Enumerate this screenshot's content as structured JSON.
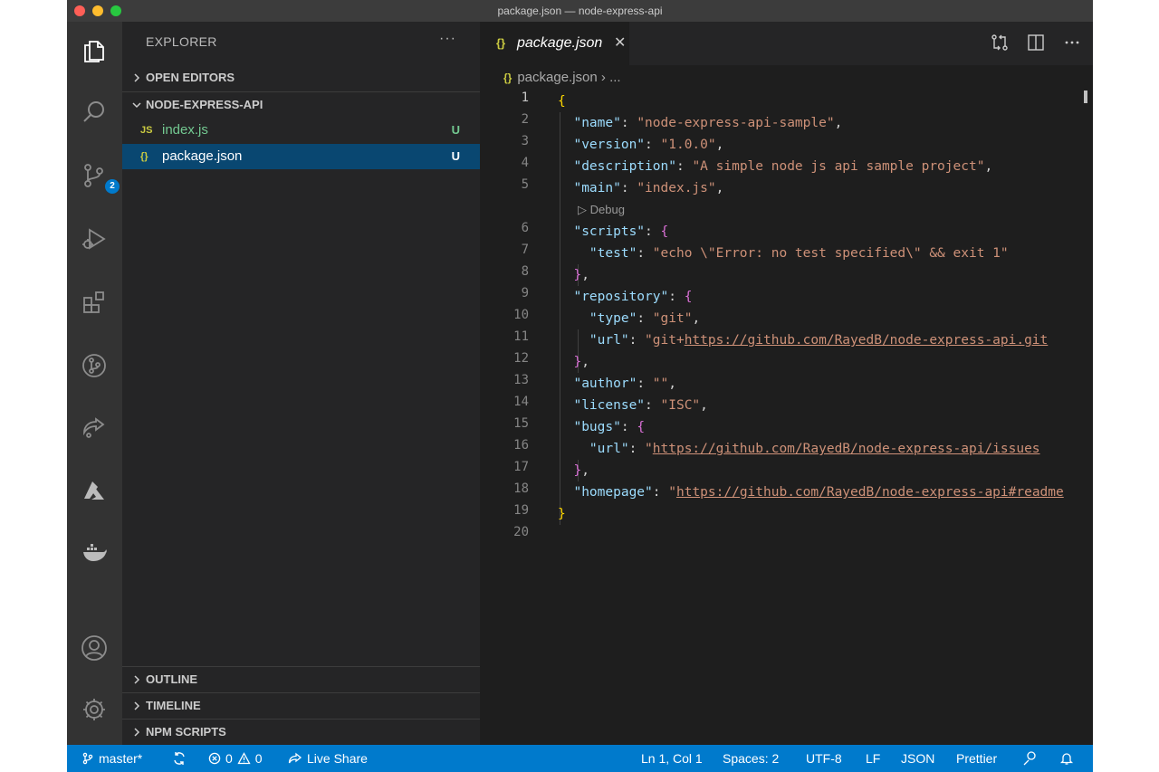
{
  "window": {
    "title": "package.json — node-express-api"
  },
  "activity_bar": {
    "icons": [
      "explorer-icon",
      "search-icon",
      "source-control-icon",
      "run-debug-icon",
      "extensions-icon",
      "git-graph-icon",
      "live-share-icon",
      "azure-icon",
      "docker-icon",
      "account-icon",
      "settings-gear-icon"
    ],
    "source_control_badge": "2"
  },
  "sidebar": {
    "title": "EXPLORER",
    "more": "···",
    "sections": {
      "open_editors": "OPEN EDITORS",
      "project": "NODE-EXPRESS-API",
      "outline": "OUTLINE",
      "timeline": "TIMELINE",
      "npm_scripts": "NPM SCRIPTS"
    },
    "files": [
      {
        "icon": "JS",
        "name": "index.js",
        "status": "U"
      },
      {
        "icon": "{}",
        "name": "package.json",
        "status": "U"
      }
    ]
  },
  "editor": {
    "tab": {
      "icon": "{}",
      "label": "package.json",
      "close": "✕"
    },
    "breadcrumb": {
      "icon": "{}",
      "file": "package.json",
      "rest": "› ..."
    },
    "codelens": "▷ Debug",
    "line_numbers": [
      "1",
      "2",
      "3",
      "4",
      "5",
      "6",
      "7",
      "8",
      "9",
      "10",
      "11",
      "12",
      "13",
      "14",
      "15",
      "16",
      "17",
      "18",
      "19",
      "20"
    ],
    "lines": {
      "l1": "{",
      "l2_key": "\"name\"",
      "l2_val": "\"node-express-api-sample\"",
      "l3_key": "\"version\"",
      "l3_val": "\"1.0.0\"",
      "l4_key": "\"description\"",
      "l4_val": "\"A simple node js api sample project\"",
      "l5_key": "\"main\"",
      "l5_val": "\"index.js\"",
      "l6_key": "\"scripts\"",
      "l6_open": "{",
      "l7_key": "\"test\"",
      "l7_val": "\"echo \\\"Error: no test specified\\\" && exit 1\"",
      "l8_close": "}",
      "l9_key": "\"repository\"",
      "l9_open": "{",
      "l10_key": "\"type\"",
      "l10_val": "\"git\"",
      "l11_key": "\"url\"",
      "l11_q": "\"git+",
      "l11_link": "https://github.com/RayedB/node-express-api.git",
      "l12_close": "}",
      "l13_key": "\"author\"",
      "l13_val": "\"\"",
      "l14_key": "\"license\"",
      "l14_val": "\"ISC\"",
      "l15_key": "\"bugs\"",
      "l15_open": "{",
      "l16_key": "\"url\"",
      "l16_q": "\"",
      "l16_link": "https://github.com/RayedB/node-express-api/issues",
      "l17_close": "}",
      "l18_key": "\"homepage\"",
      "l18_q": "\"",
      "l18_link": "https://github.com/RayedB/node-express-api#readme",
      "l19": "}"
    }
  },
  "status_bar": {
    "branch": "master*",
    "errors": "0",
    "warnings": "0",
    "live_share": "Live Share",
    "position": "Ln 1, Col 1",
    "spaces": "Spaces: 2",
    "encoding": "UTF-8",
    "eol": "LF",
    "language": "JSON",
    "formatter": "Prettier"
  },
  "colors": {
    "accent": "#007acc",
    "untracked": "#73c991",
    "json_key": "#9cdcfe",
    "json_string": "#ce9178"
  }
}
